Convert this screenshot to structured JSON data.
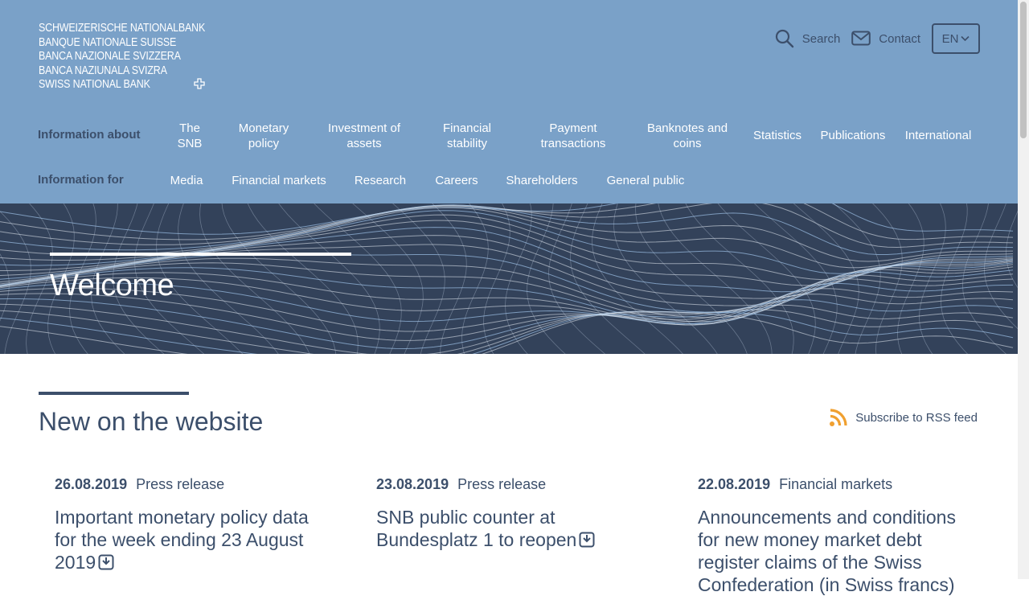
{
  "logo": {
    "lines": [
      "SCHWEIZERISCHE NATIONALBANK",
      "BANQUE NATIONALE SUISSE",
      "BANCA NAZIONALE SVIZZERA",
      "BANCA NAZIUNALA SVIZRA",
      "SWISS NATIONAL BANK"
    ]
  },
  "tools": {
    "search": "Search",
    "contact": "Contact",
    "language": "EN"
  },
  "nav_about": {
    "label": "Information about",
    "items": [
      {
        "l1": "The",
        "l2": "SNB"
      },
      {
        "l1": "Monetary",
        "l2": "policy"
      },
      {
        "l1": "Investment of",
        "l2": "assets"
      },
      {
        "l1": "Financial",
        "l2": "stability"
      },
      {
        "l1": "Payment",
        "l2": "transactions"
      },
      {
        "l1": "Banknotes and",
        "l2": "coins"
      },
      {
        "l1": "Statistics",
        "l2": ""
      },
      {
        "l1": "Publications",
        "l2": ""
      },
      {
        "l1": "International",
        "l2": ""
      }
    ]
  },
  "nav_for": {
    "label": "Information for",
    "items": [
      "Media",
      "Financial markets",
      "Research",
      "Careers",
      "Shareholders",
      "General public"
    ]
  },
  "hero": {
    "title": "Welcome"
  },
  "section": {
    "title": "New on the website",
    "rss": "Subscribe to RSS feed"
  },
  "news": [
    {
      "date": "26.08.2019",
      "category": "Press release",
      "title": "Important monetary policy data for the week ending 23 August 2019"
    },
    {
      "date": "23.08.2019",
      "category": "Press release",
      "title": "SNB public counter at Bundesplatz 1 to reopen"
    },
    {
      "date": "22.08.2019",
      "category": "Financial markets",
      "title": "Announcements and conditions for new money market debt register claims of the Swiss Confederation (in Swiss francs)"
    }
  ],
  "colors": {
    "header_bg": "#7aa1c8",
    "dark_text": "#3c4f6b",
    "hero_bg": "#33425a",
    "rss_orange": "#f0a030"
  }
}
